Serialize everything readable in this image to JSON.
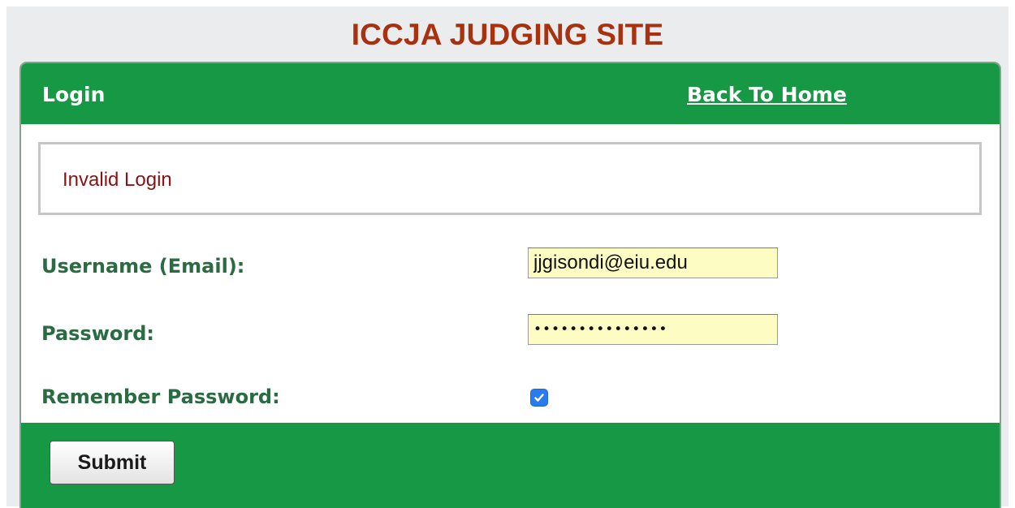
{
  "site_title": "ICCJA JUDGING SITE",
  "header": {
    "label": "Login",
    "back_link": "Back To Home"
  },
  "message": "Invalid Login",
  "form": {
    "username_label": "Username (Email):",
    "username_value": "jjgisondi@eiu.edu",
    "password_label": "Password:",
    "password_value": "•••••••••••••••",
    "remember_label": "Remember Password:",
    "remember_checked": true,
    "submit_label": "Submit"
  },
  "colors": {
    "title": "#a8310f",
    "header_green": "#169845",
    "label_green": "#2a6b44",
    "error_red": "#8a1212",
    "input_bg": "#fdfdc3",
    "checkbox_blue": "#2a7bf0"
  },
  "icons": {
    "checkbox": "checkmark-icon"
  }
}
